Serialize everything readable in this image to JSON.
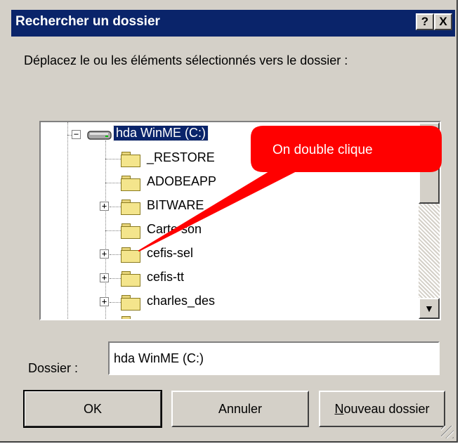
{
  "window": {
    "title": "Rechercher un dossier",
    "help_button": "?",
    "close_button": "X"
  },
  "prompt": "Déplacez le ou les  éléments sélectionnés vers le dossier :",
  "tree": {
    "root": {
      "label": "hda WinME (C:)",
      "expander": "−",
      "selected": true
    },
    "items": [
      {
        "label": "_RESTORE",
        "expander": ""
      },
      {
        "label": "ADOBEAPP",
        "expander": ""
      },
      {
        "label": "BITWARE",
        "expander": "+"
      },
      {
        "label": "Carte son",
        "expander": ""
      },
      {
        "label": "cefis-sel",
        "expander": "+"
      },
      {
        "label": "cefis-tt",
        "expander": "+"
      },
      {
        "label": "charles_des",
        "expander": "+"
      }
    ]
  },
  "scrollbar": {
    "up_arrow": "▲",
    "down_arrow": "▼",
    "position": 0.12
  },
  "callout": {
    "text": "On double clique",
    "color": "#ff0000"
  },
  "folder_field": {
    "label": "Dossier :",
    "value": "hda WinME (C:)"
  },
  "buttons": {
    "ok": "OK",
    "cancel": "Annuler",
    "new_folder": "Nouveau dossier"
  },
  "colors": {
    "title_bar": "#0a246a",
    "dialog_face": "#d4d0c8",
    "selection": "#0a246a"
  }
}
